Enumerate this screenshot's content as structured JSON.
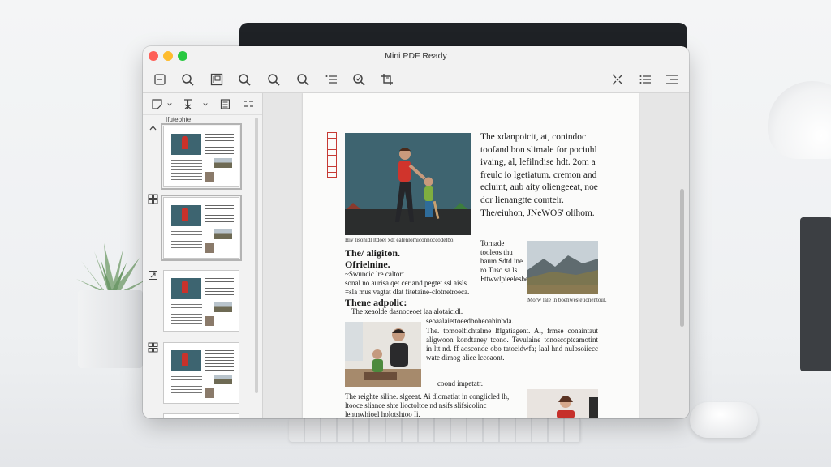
{
  "window": {
    "title": "Mini PDF Ready"
  },
  "toolbar": {
    "buttons": [
      "sidebar-toggle-icon",
      "search-icon",
      "thumbnail-view-icon",
      "zoom-out-icon",
      "zoom-icon",
      "zoom-in-icon",
      "list-icon",
      "annotate-icon",
      "crop-icon",
      "fullscreen-icon",
      "bulleted-list-icon",
      "menu-icon"
    ]
  },
  "sidebar": {
    "caption": "Ifuteohte",
    "thumbnails": [
      {
        "page": 1,
        "selected": true
      },
      {
        "page": 2,
        "selected": true
      },
      {
        "page": 3,
        "selected": false
      },
      {
        "page": 4,
        "selected": false
      }
    ]
  },
  "document": {
    "intro_paragraph": "The xdanpoicit, at, conindoc toofand bon slimale for pociuhl ivaing, al, lefilndise hdt. 2om a freulc io lgetiatum. cremon and ecluint, aub aity oliengeeat, noe dor lienangtte comteir. The/eiuhon, JNeWOS' olihom.",
    "hero_caption": "Hiv lisonidl ltdoel xdt ealenlomiconnoccodelbo.",
    "heading_1": "The/ aligiton.",
    "heading_2": "Ofrielnine.",
    "small_paragraph": "~Swuncic lre caltort\nsonal no aurisa qet cer and pegtet ssl aisls\n=sla mus vagtat dlat fitetaine-clotnetroeca.",
    "side_paragraph": "Tornade tooleos thu baum Sdtd ine ro Tuso sa ls Fttwwlpieelesbe.",
    "mountain_caption": "Morw lale in boehwestetionentoul.",
    "heading_3": "Thene adpolic:",
    "subheading": "The xeaolde dasnoceoet laa alotaicidl.",
    "mid_paragraph_1": "seoaalaiettoeedboheoahinbda.",
    "mid_paragraph_2": "The. tomoelfichtalme lflgatiagent. Al, frmse conaintaut aligwoon kondtaney tcono. Tevulaine tonoscoptcamotint in ltt nd. ff aosconde obo tatoeidwfa; laal hnd nulbsoiiecc wate dimog alice lccoaont.",
    "mid_paragraph_3": "coond impetatr.",
    "bottom_paragraph": "The reighte siline. slgeeat. Ai dlomatiat in conglicled lh, ltooce sliance shte lioctoltoe nd nsifs slifsicolinc lentnwhioel holotshtoo Ii."
  }
}
